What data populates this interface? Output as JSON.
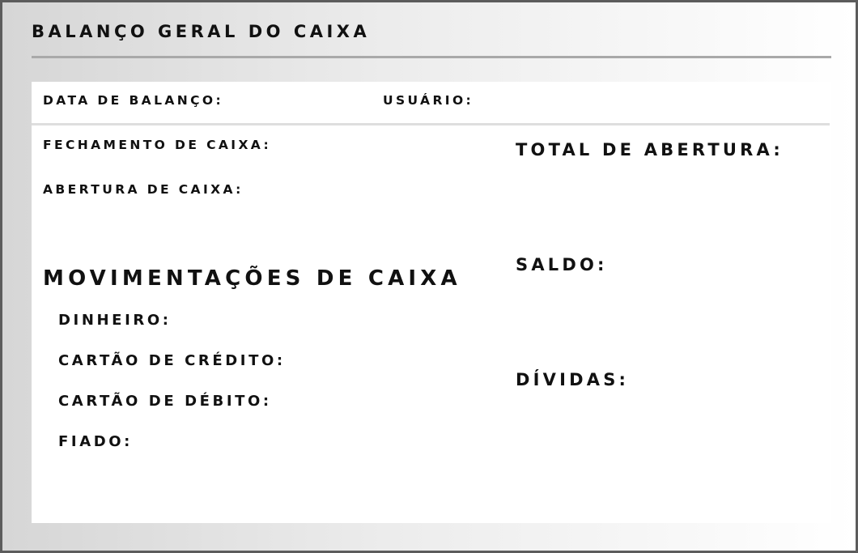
{
  "window": {
    "title": "BALANÇO GERAL DO CAIXA"
  },
  "header": {
    "date_label": "DATA DE BALANÇO:",
    "user_label": "USUÁRIO:"
  },
  "left": {
    "closing_label": "FECHAMENTO DE CAIXA:",
    "opening_label": "ABERTURA DE CAIXA:",
    "movements_title": "MOVIMENTAÇÕES DE CAIXA",
    "movements": {
      "cash_label": "DINHEIRO:",
      "credit_label": "CARTÃO DE CRÉDITO:",
      "debit_label": "CARTÃO DE DÉBITO:",
      "credit_sale_label": "FIADO:"
    }
  },
  "right": {
    "total_opening_label": "TOTAL DE ABERTURA:",
    "balance_label": "SALDO:",
    "debts_label": "DÍVIDAS:"
  },
  "colors": {
    "text": "#111111",
    "border": "#5c5c5c",
    "rule": "#a9a9a9",
    "panel": "#ffffff"
  }
}
